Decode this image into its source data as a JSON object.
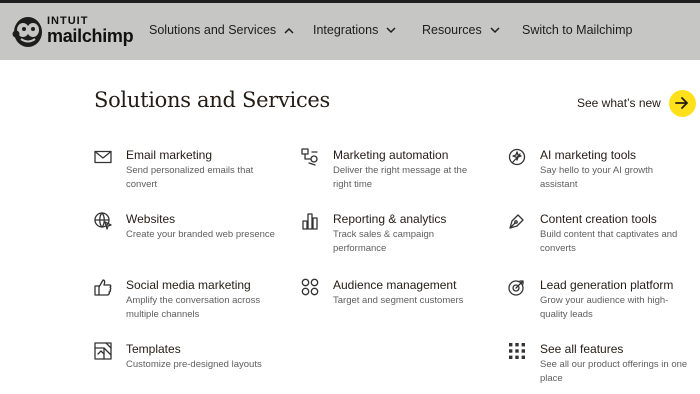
{
  "brand": {
    "top": "INTUIT",
    "main": "mailchimp"
  },
  "nav": [
    {
      "label": "Solutions and Services"
    },
    {
      "label": "Integrations"
    },
    {
      "label": "Resources"
    },
    {
      "label": "Switch to Mailchimp"
    }
  ],
  "panel": {
    "title": "Solutions and Services",
    "whats_new": "See what’s new"
  },
  "items": [
    {
      "icon": "envelope-icon",
      "title": "Email marketing",
      "desc": "Send personalized emails that convert"
    },
    {
      "icon": "workflow-icon",
      "title": "Marketing automation",
      "desc": "Deliver the right message at the right time"
    },
    {
      "icon": "ai-sparkle-icon",
      "title": "AI marketing tools",
      "desc": "Say hello to your AI growth assistant"
    },
    {
      "icon": "globe-cursor-icon",
      "title": "Websites",
      "desc": "Create your branded web presence"
    },
    {
      "icon": "bar-chart-icon",
      "title": "Reporting & analytics",
      "desc": "Track sales & campaign performance"
    },
    {
      "icon": "pen-nib-icon",
      "title": "Content creation tools",
      "desc": "Build content that captivates and converts"
    },
    {
      "icon": "thumbs-up-icon",
      "title": "Social media marketing",
      "desc": "Amplify the conversation across multiple channels"
    },
    {
      "icon": "audience-icon",
      "title": "Audience management",
      "desc": "Target and segment customers"
    },
    {
      "icon": "lead-generation-icon",
      "title": "Lead generation platform",
      "desc": "Grow your audience with high-quality leads"
    },
    {
      "icon": "template-icon",
      "title": "Templates",
      "desc": "Customize pre-designed layouts"
    },
    {
      "icon": "grid-icon",
      "title": "See all features",
      "desc": "See all our product offerings in one place"
    }
  ]
}
